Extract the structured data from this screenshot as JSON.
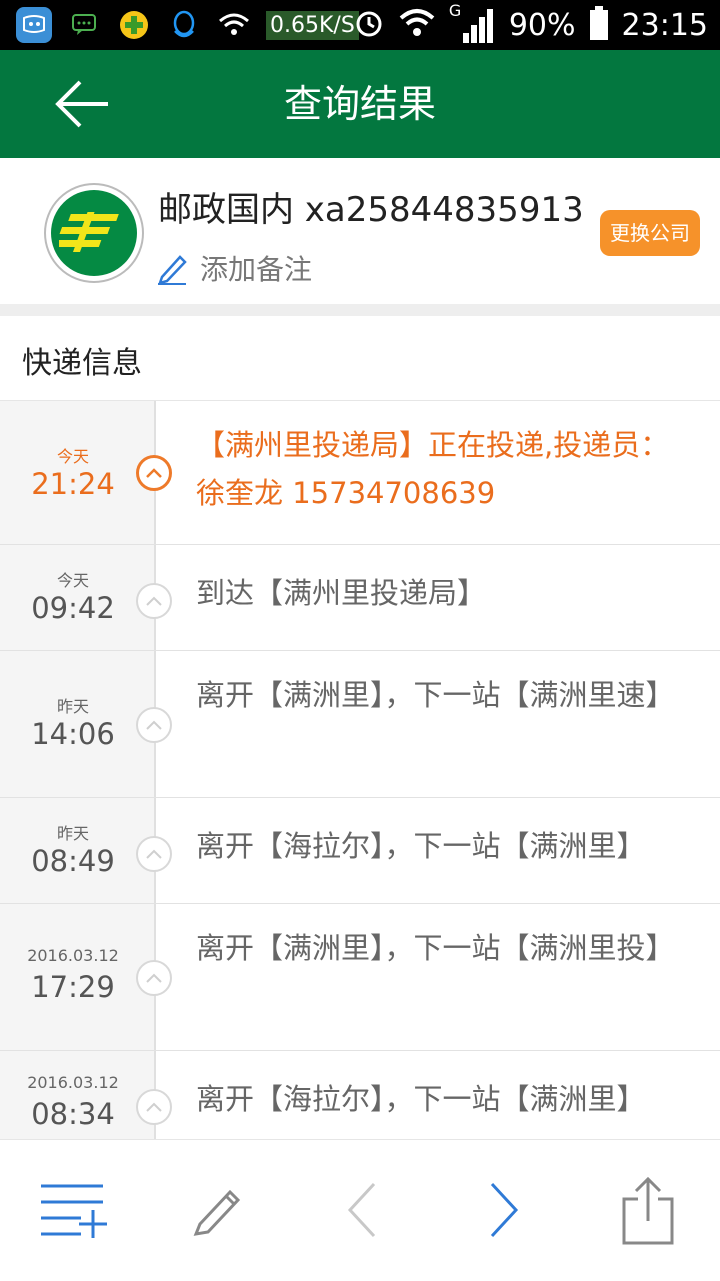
{
  "status_bar": {
    "net_speed": "0.65K/S",
    "signal_type": "G",
    "battery": "90%",
    "time": "23:15"
  },
  "app_bar": {
    "title": "查询结果"
  },
  "company": {
    "name": "邮政国内 xa25844835913",
    "note_label": "添加备注",
    "change_button": "更换公司"
  },
  "section": {
    "title": "快递信息"
  },
  "timeline": [
    {
      "date": "今天",
      "time": "21:24",
      "text": "【满州里投递局】正在投递,投递员：徐奎龙 15734708639",
      "active": true
    },
    {
      "date": "今天",
      "time": "09:42",
      "text": "到达【满州里投递局】",
      "active": false
    },
    {
      "date": "昨天",
      "time": "14:06",
      "text": "离开【满洲里】，下一站【满洲里速】",
      "active": false
    },
    {
      "date": "昨天",
      "time": "08:49",
      "text": "离开【海拉尔】，下一站【满洲里】",
      "active": false
    },
    {
      "date": "2016.03.12",
      "time": "17:29",
      "text": "离开【满洲里】，下一站【满洲里投】",
      "active": false
    },
    {
      "date": "2016.03.12",
      "time": "08:34",
      "text": "离开【海拉尔】，下一站【满洲里】",
      "active": false
    }
  ],
  "colors": {
    "app_bar": "#03773f",
    "accent_orange": "#ea6d1d",
    "change_button": "#f6922a",
    "nav_blue": "#2f7ad6"
  },
  "icons": {
    "back": "arrow-left-icon",
    "note": "pencil-icon",
    "toolbar": [
      "list-add-icon",
      "pencil-icon",
      "chevron-left-icon",
      "chevron-right-icon",
      "share-icon"
    ]
  }
}
